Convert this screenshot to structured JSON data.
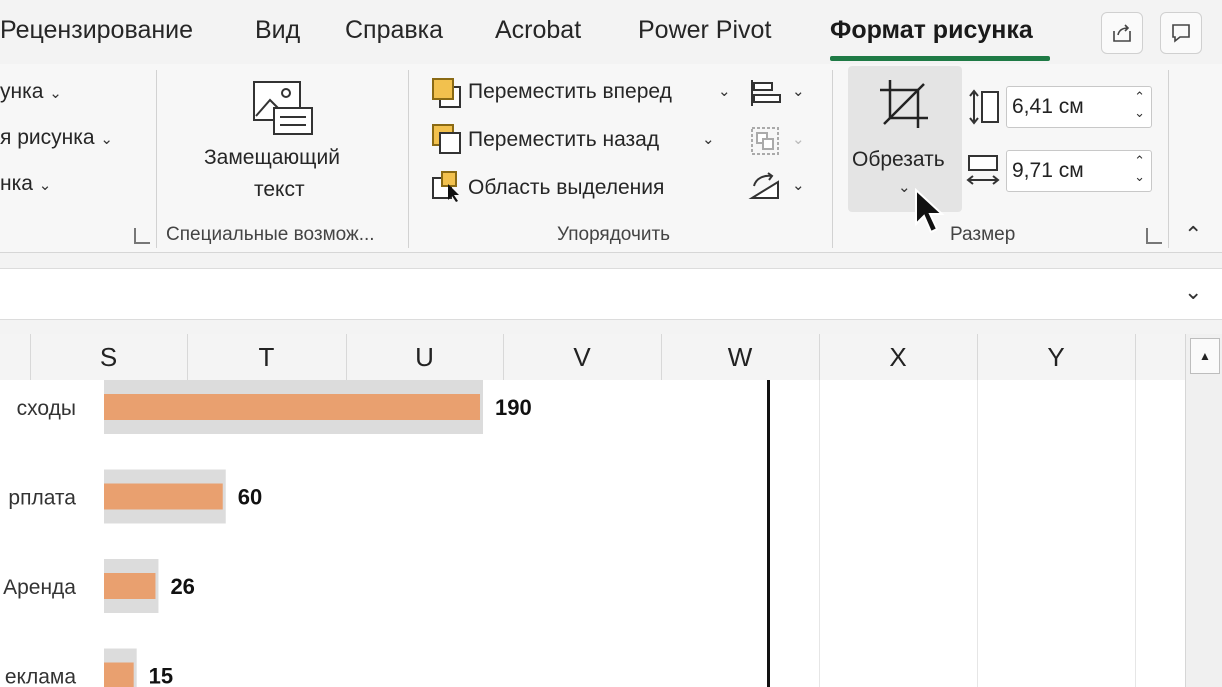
{
  "tabs": [
    {
      "label": "Рецензирование",
      "active": false
    },
    {
      "label": "Вид",
      "active": false
    },
    {
      "label": "Справка",
      "active": false
    },
    {
      "label": "Acrobat",
      "active": false
    },
    {
      "label": "Power Pivot",
      "active": false
    },
    {
      "label": "Формат рисунка",
      "active": true
    }
  ],
  "ribbon": {
    "left_group": {
      "items": [
        "унка",
        "я рисунка",
        "нка"
      ]
    },
    "accessibility": {
      "alt_text_line1": "Замещающий",
      "alt_text_line2": "текст",
      "group_label": "Специальные возмож..."
    },
    "arrange": {
      "bring_forward": "Переместить вперед",
      "send_backward": "Переместить назад",
      "selection_pane": "Область выделения",
      "group_label": "Упорядочить"
    },
    "size": {
      "crop_label": "Обрезать",
      "height_value": "6,41 см",
      "width_value": "9,71 см",
      "group_label": "Размер"
    }
  },
  "columns": [
    "S",
    "T",
    "U",
    "V",
    "W",
    "X",
    "Y"
  ],
  "chart_data": {
    "type": "bar",
    "categories": [
      "сходы",
      "рплата",
      "Аренда",
      "еклама"
    ],
    "values": [
      190,
      60,
      26,
      15
    ],
    "data_labels": [
      "190",
      "60",
      "26",
      "15"
    ],
    "colors": {
      "bar": "#e9a06f",
      "shadow": "#dcdcdc"
    }
  },
  "colors": {
    "accent": "#1e7a45",
    "window_bg": "#f3f3f3"
  }
}
